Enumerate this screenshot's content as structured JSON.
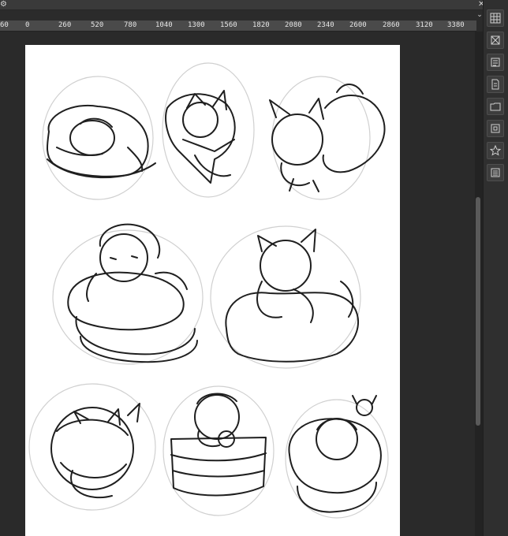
{
  "window": {
    "gear_icon": "gear-icon",
    "close_glyph": "✕"
  },
  "ruler": {
    "ticks": [
      "60",
      "0",
      "260",
      "520",
      "780",
      "1040",
      "1300",
      "1560",
      "1820",
      "2080",
      "2340",
      "2600",
      "2860",
      "3120",
      "3380"
    ],
    "expand_glyph": "⌄"
  },
  "canvas": {
    "content": "sketch of eight chibi characters with food items",
    "paper_color": "#ffffff",
    "stroke_color": "#1f1f1f",
    "guide_color": "#d0d0d0"
  },
  "right_panel": {
    "tools": [
      {
        "icon": "grid-icon"
      },
      {
        "icon": "crop-icon"
      },
      {
        "icon": "layers-icon"
      },
      {
        "icon": "document-icon"
      },
      {
        "icon": "folder-icon"
      },
      {
        "icon": "frame-icon"
      },
      {
        "icon": "star-icon"
      },
      {
        "icon": "list-icon"
      }
    ]
  },
  "colors": {
    "workspace": "#2a2a2a",
    "ruler": "#4a4a4a",
    "panel": "#2f2f2f",
    "scroll_thumb": "#5a5a5a"
  }
}
